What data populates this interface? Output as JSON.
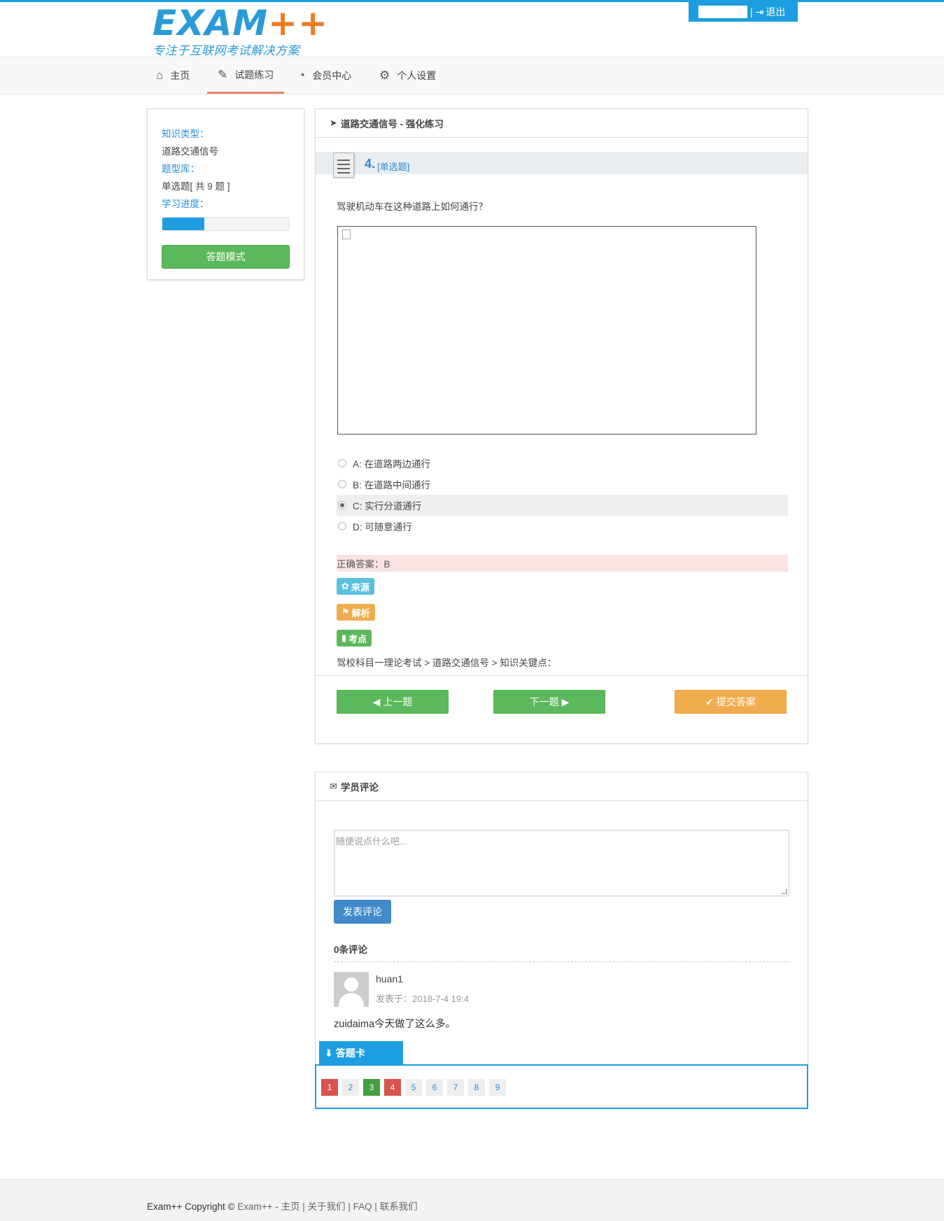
{
  "header": {
    "logo_main": "EXAM",
    "logo_plus": "++",
    "logo_sub": "专注于互联网考试解决方案",
    "logout_label": "退出"
  },
  "nav": {
    "items": [
      {
        "label": "主页",
        "icon": "home-icon"
      },
      {
        "label": "试题练习",
        "icon": "edit-icon",
        "active": true
      },
      {
        "label": "会员中心",
        "icon": "dashboard-icon"
      },
      {
        "label": "个人设置",
        "icon": "gears-icon"
      }
    ]
  },
  "sidebar": {
    "knowledge_label": "知识类型：",
    "knowledge_value": "道路交通信号",
    "bank_label": "题型库：",
    "bank_value": "单选题[ 共 9 题 ]",
    "progress_label": "学习进度：",
    "progress": 0.33,
    "mode_button": "答题模式"
  },
  "question_panel": {
    "title": "道路交通信号 - 强化练习",
    "number": "4.",
    "type": "[单选题]",
    "text": "驾驶机动车在这种道路上如何通行？",
    "options": [
      {
        "label": "A: 在道路两边通行",
        "selected": false
      },
      {
        "label": "B: 在道路中间通行",
        "selected": false
      },
      {
        "label": "C: 实行分道通行",
        "selected": true
      },
      {
        "label": "D: 可随意通行",
        "selected": false
      }
    ],
    "answer": "正确答案：B",
    "tag_source": "来源",
    "tag_analysis": "解析",
    "tag_keypoint": "考点",
    "breadcrumb": "驾校科目一理论考试 > 道路交通信号 > 知识关键点：",
    "prev_button": "上一题",
    "next_button": "下一题",
    "submit_button": "提交答案"
  },
  "comments": {
    "title": "学员评论",
    "placeholder": "随便说点什么吧...",
    "post_button": "发表评论",
    "count": "0条评论",
    "items": [
      {
        "user": "huan1",
        "time": "发表于：2018-7-4 19:4",
        "content": "zuidaima今天做了这么多。"
      }
    ]
  },
  "answer_card": {
    "title": "答题卡",
    "numbers": [
      {
        "n": "1",
        "state": "wrong"
      },
      {
        "n": "2",
        "state": "none"
      },
      {
        "n": "3",
        "state": "right"
      },
      {
        "n": "4",
        "state": "wrong"
      },
      {
        "n": "5",
        "state": "none"
      },
      {
        "n": "6",
        "state": "none"
      },
      {
        "n": "7",
        "state": "none"
      },
      {
        "n": "8",
        "state": "none"
      },
      {
        "n": "9",
        "state": "none"
      }
    ]
  },
  "footer": {
    "copyright": "Exam++ Copyright ©",
    "links": "Exam++ - 主页 | 关于我们 | FAQ | 联系我们"
  },
  "colors": {
    "accent": "#1c9ee0",
    "green": "#5cb85c",
    "orange": "#f0ad4e",
    "red": "#d9534f",
    "nav_active": "#e8826e"
  }
}
